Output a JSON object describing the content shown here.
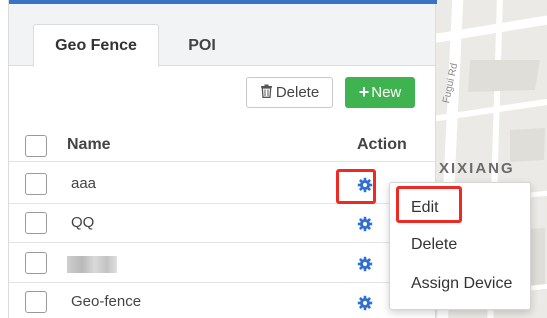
{
  "tabs": [
    {
      "label": "Geo Fence",
      "active": true
    },
    {
      "label": "POI",
      "active": false
    }
  ],
  "toolbar": {
    "delete_label": "Delete",
    "new_label": "New"
  },
  "table": {
    "headers": {
      "name": "Name",
      "action": "Action"
    },
    "rows": [
      {
        "name": "aaa"
      },
      {
        "name": "QQ"
      },
      {
        "name": "",
        "redacted": true
      },
      {
        "name": "Geo-fence"
      }
    ]
  },
  "context_menu": {
    "items": [
      "Edit",
      "Delete",
      "Assign Device"
    ]
  },
  "map": {
    "road_label": "Fugui Rd",
    "area_label": "XIXIANG"
  },
  "colors": {
    "accent_blue": "#3a72c4",
    "new_button": "#3fb34f",
    "highlight": "#ee2a24",
    "gear_icon": "#2f6fd1"
  }
}
